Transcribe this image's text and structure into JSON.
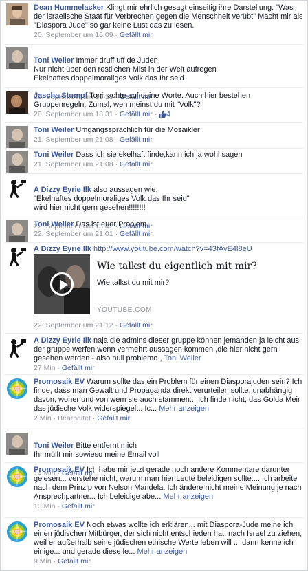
{
  "comments": [
    {
      "name": "Dean Hummelacker",
      "text": "Klingt mir ehrlich gesagt einseitig ihre Darstellung. \"Was der israelische Staat für Verbrechen gegen die Menschheit verübt\" Macht mir als \"Diaspora Jude\" so gar keine Lust das zu lesen.",
      "date": "20. September um 16:09",
      "like": "Gefällt mir"
    },
    {
      "name": "Toni Weiler",
      "text": "Immer druff uff de Juden\nNur nicht über den restlichen Mist in der Welt aufregen\nEkelhaftes doppelmoraliges Volk das Ihr seid",
      "date": "20. September um 16:13",
      "like": "Gefällt mir"
    },
    {
      "name": "Jascha Stumpf",
      "text": "Toni, achte auf deine Worte. Auch hier bestehen Gruppenregeln. Zumal, wen meinst du mit \"Volk\"?",
      "date": "20. September um 18:31",
      "like": "Gefällt mir",
      "likes_count": "4"
    },
    {
      "name": "Toni Weiler",
      "text": "Umgangssprachlich für die Mosaikler",
      "date": "21. September um 21:08",
      "like": "Gefällt mir"
    },
    {
      "name": "Toni Weiler",
      "text": "Dass ich sie ekelhaft finde,kann ich ja wohl sagen",
      "date": "21. September um 21:08",
      "like": "Gefällt mir"
    },
    {
      "name": "A Dizzy Eyrie Ilk",
      "text": "also aussagen wie:\n\"Ekelhaftes doppelmoraliges Volk das Ihr seid\"\nwird hier nicht gern gesehen!!!!!!!!",
      "date": "22. September um 13:42",
      "like": "Gefällt mir"
    },
    {
      "name": "Toni Weiler",
      "text": "Das ist euer Problem",
      "date": "22. September um 21:01",
      "like": "Gefällt mir"
    },
    {
      "name": "A Dizzy Eyrie Ilk",
      "link": "http://www.youtube.com/watch?v=43fAvE4l8eU",
      "date": "22. September um 21:12",
      "like": "Gefällt mir"
    },
    {
      "name": "A Dizzy Eyrie Ilk",
      "text": "naja die admins dieser gruppe können jemanden ja leicht aus der gruppe werfen wenn vermehrt aussagen kommen ,die hier nicht gern gesehen werden - also null problemo , ",
      "mention": "Toni Weiler",
      "date": "27 Min",
      "like": "Gefällt mir"
    },
    {
      "name": "Promosaik EV",
      "text": "Warum sollte das ein Problem für einen Diasporajuden sein? Ich finde, dass man Gewalt und Propaganda direkt verurteilen sollte, unabhängig davon, woher und von wem sie auch stammen... Ich finde nicht, das Golda Meir das jüdische Volk widerspiegelt.. Ic... ",
      "more": "Mehr anzeigen",
      "date": "2 Min",
      "edited": "Bearbeitet",
      "like": "Gefällt mir"
    },
    {
      "name": "Toni Weiler",
      "text": "Bitte entfernt mich\nIhr müllt mir sowieso meine Email voll",
      "date": "14 Min",
      "like": "Gefällt mir"
    },
    {
      "name": "Promosaik EV",
      "text": "Ich habe mir jetzt gerade noch andere Kommentare darunter gelesen... verstehe nicht, warum man hier Leute beleidigen sollte.... Ich arbeite nach dem Prinzip von Nelson Mandela. Ich ändere nicht meine Meinung je nach Ansprechpartner... Ich beleidige abe... ",
      "more": "Mehr anzeigen",
      "date": "13 Min",
      "like": "Gefällt mir"
    },
    {
      "name": "Promosaik EV",
      "text": "Noch etwas wollte ich erklären... mit Diaspora-Jude meine ich einen jüdischen Mitbürger, der sich nicht entschieden hat, nach Israel zu ziehen, weil er außerhalb seine jüdischen ethische Werte leben will ... dann kenne ich einige... und gerade diese le... ",
      "more": "Mehr anzeigen",
      "date": "9 Min",
      "like": "Gefällt mir"
    }
  ],
  "preview": {
    "title": "Wie talkst du eigentlich mit mir?",
    "description": "Wie talkst du mit mir?",
    "source": "YOUTUBE.COM"
  },
  "colors": {
    "link": "#3b5998",
    "meta": "#90949c",
    "text": "#141823"
  }
}
